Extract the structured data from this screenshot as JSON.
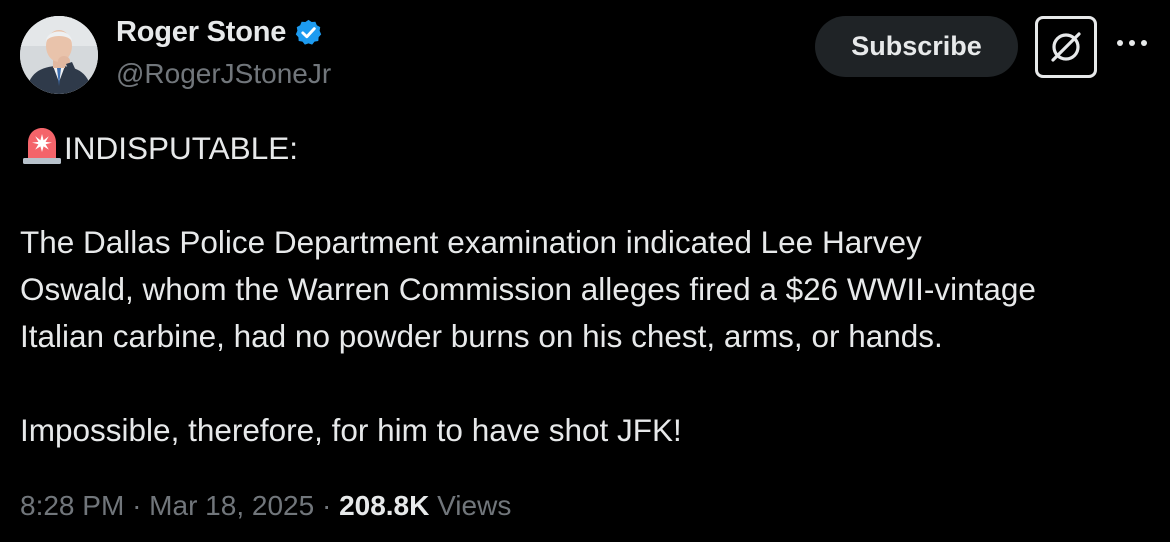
{
  "author": {
    "display_name": "Roger Stone",
    "handle": "@RogerJStoneJr",
    "verified": true,
    "verified_color": "#1d9bf0"
  },
  "actions": {
    "subscribe_label": "Subscribe",
    "grok_icon": "slashed-circle-icon",
    "more_icon": "more-dots-icon"
  },
  "post": {
    "headline_emoji": "police-siren-emoji",
    "headline": "INDISPUTABLE:",
    "paragraph_lines": [
      "The Dallas Police Department examination indicated Lee Harvey",
      "Oswald, whom the Warren Commission alleges fired a $26 WWII-vintage",
      "Italian carbine, had no powder burns on his chest, arms, or hands."
    ],
    "closing": "Impossible, therefore, for him to have shot JFK!"
  },
  "meta": {
    "time": "8:28 PM",
    "separator": "·",
    "date": "Mar 18, 2025",
    "views_count": "208.8K",
    "views_label": "Views"
  },
  "colors": {
    "background": "#000000",
    "text_primary": "#e7e9ea",
    "text_secondary": "#71767b",
    "subscribe_bg": "#1f2326"
  }
}
